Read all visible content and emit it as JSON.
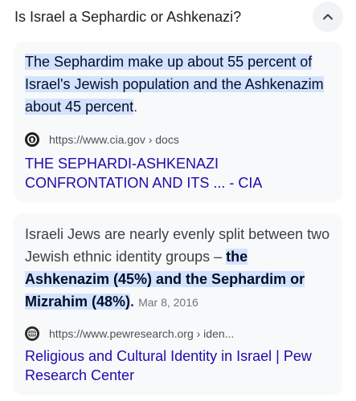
{
  "question": {
    "text": "Is Israel a Sephardic or Ashkenazi?",
    "toggle_icon": "chevron-up-icon"
  },
  "results": [
    {
      "snippet_highlight": "The Sephardim make up about 55 percent of Israel's Jewish population and the Ashkenazim about 45 percent",
      "snippet_tail": ".",
      "favicon": "cia-seal-icon",
      "url": "https://www.cia.gov › docs",
      "title": "THE SEPHARDI-ASHKENAZI CONFRONTATION AND ITS ... - CIA"
    },
    {
      "snippet_lead": "Israeli Jews are nearly evenly split between two Jewish ethnic identity groups – ",
      "snippet_highlight": "the Ashkenazim (45%) and the Sephardim or Mizrahim (48%)",
      "snippet_tail": ".",
      "date": "Mar 8, 2016",
      "favicon": "pew-globe-icon",
      "url": "https://www.pewresearch.org › iden...",
      "title": "Religious and Cultural Identity in Israel | Pew Research Center"
    }
  ],
  "colors": {
    "highlight": "#d3e3fd",
    "link": "#1a0dab",
    "card_bg": "#f8f9fa"
  }
}
